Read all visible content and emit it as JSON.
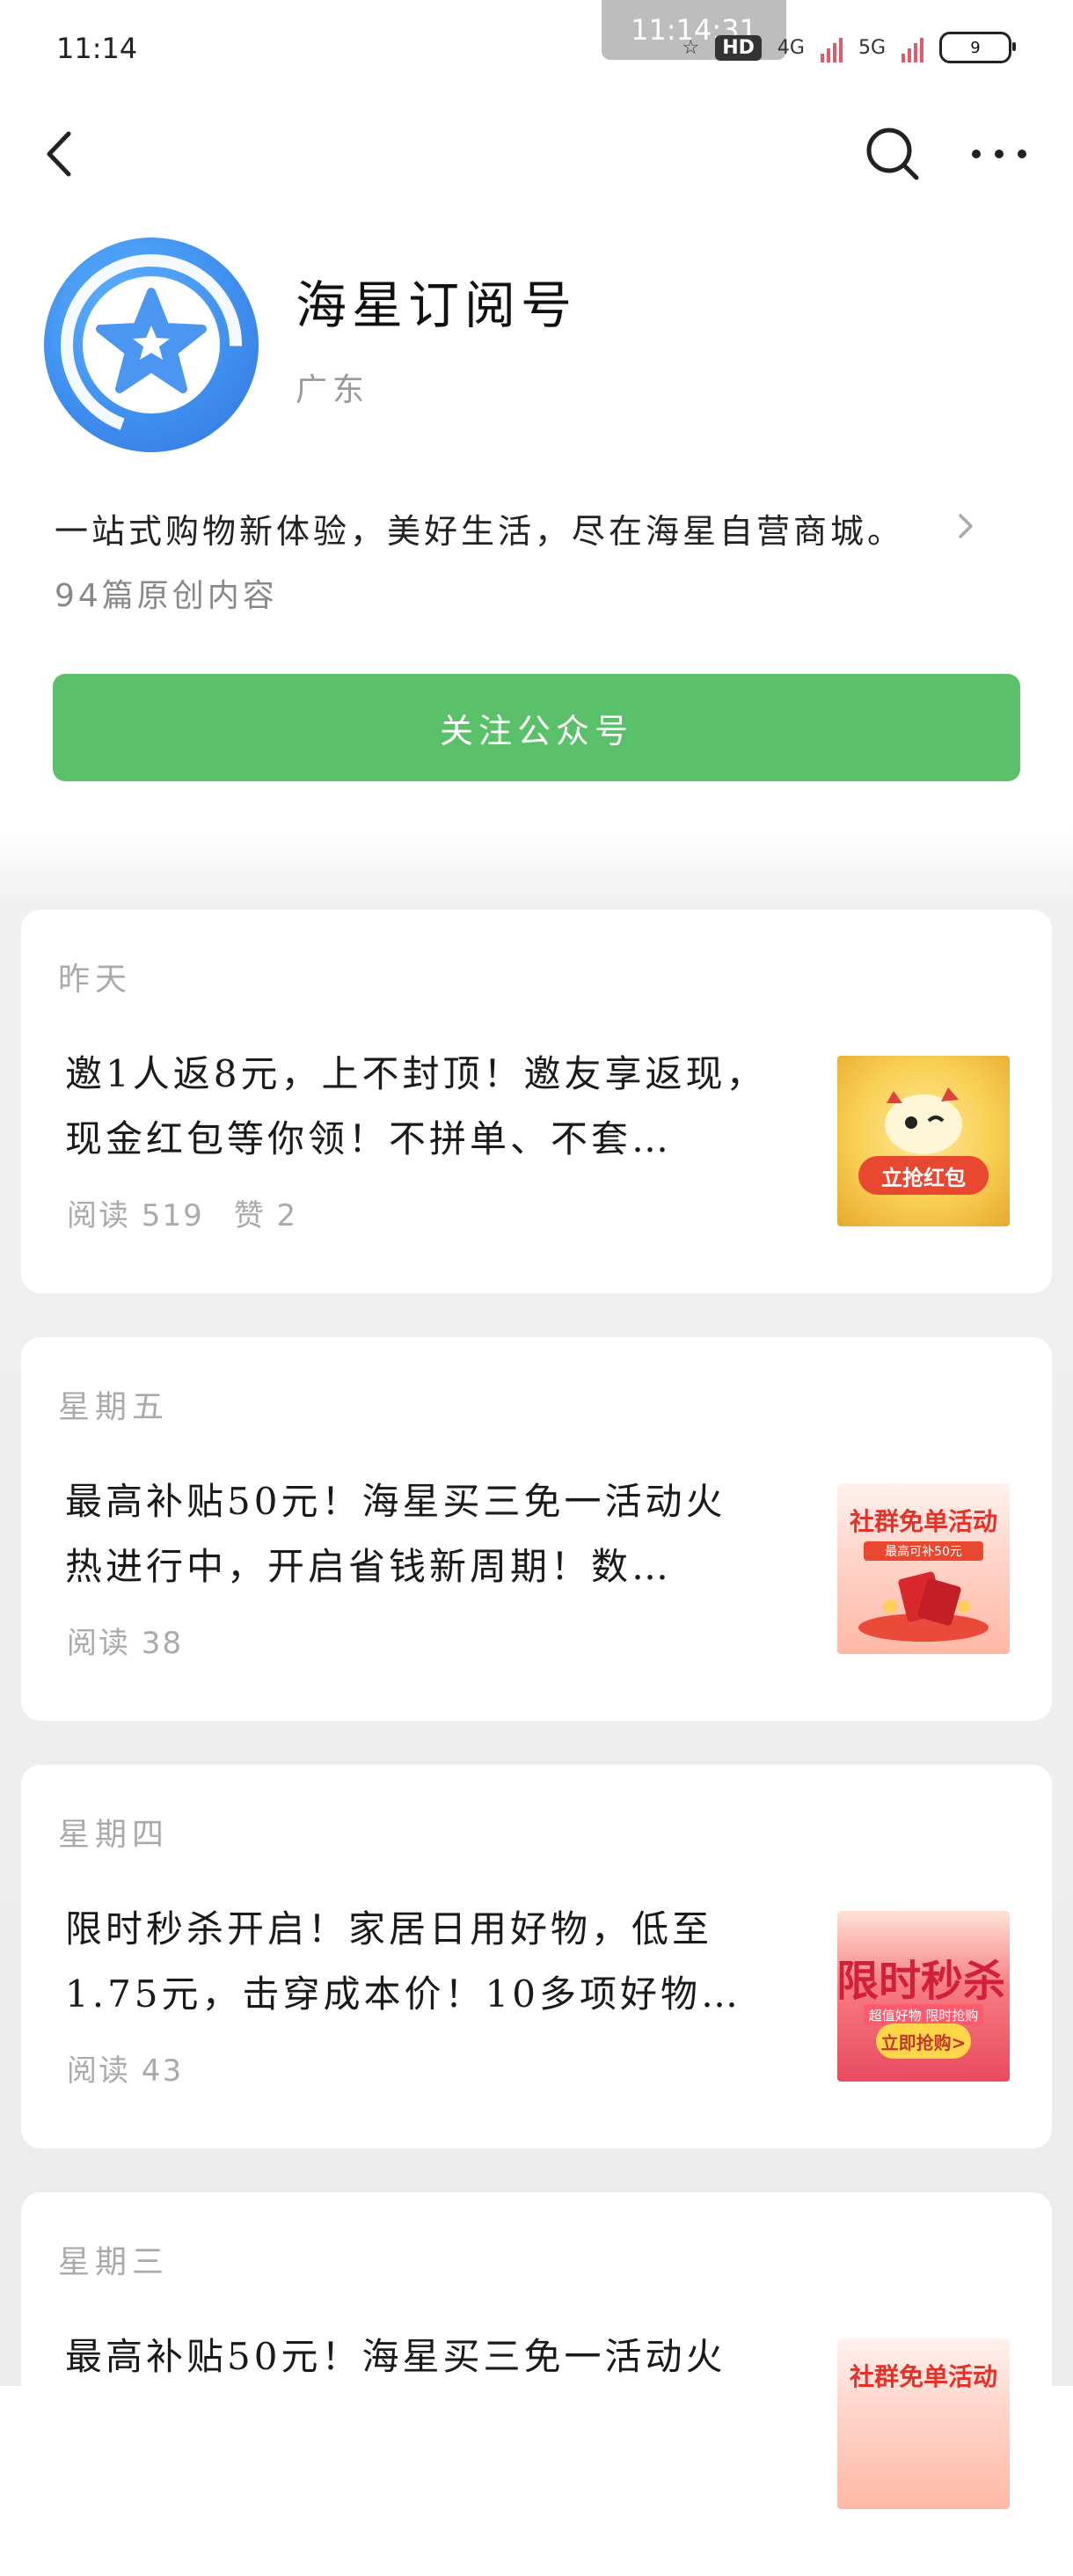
{
  "status_bar": {
    "time": "11:14",
    "recorder_time": "11:14:31",
    "hd_label": "HD",
    "network_4g": "4G",
    "network_5g": "5G",
    "battery": "9"
  },
  "nav": {
    "back_icon": "chevron-left-icon",
    "search_icon": "search-icon",
    "more_icon": "more-horizontal-icon"
  },
  "profile": {
    "name": "海星订阅号",
    "region": "广东",
    "description": "一站式购物新体验，美好生活，尽在海星自营商城。",
    "original_count": "94篇原创内容",
    "follow_label": "关注公众号",
    "avatar_colors": {
      "primary": "#3f8fef",
      "star": "#ffffff"
    },
    "follow_color": "#5ac06a"
  },
  "articles": [
    {
      "day": "昨天",
      "title_line1": "邀1人返8元，上不封顶！邀友享返现，",
      "title_line2": "现金红包等你领！不拼单、不套…",
      "reads": "阅读 519",
      "likes": "赞 2",
      "thumb_text": "立抢红包"
    },
    {
      "day": "星期五",
      "title_line1": "最高补贴50元！海星买三免一活动火",
      "title_line2": "热进行中，开启省钱新周期！数…",
      "reads": "阅读 38",
      "thumb_text": "社群免单活动",
      "thumb_sub": "最高可补50元"
    },
    {
      "day": "星期四",
      "title_line1": "限时秒杀开启！家居日用好物，低至",
      "title_line2": "1.75元，击穿成本价！10多项好物…",
      "reads": "阅读 43",
      "thumb_text": "限时秒杀",
      "thumb_sub": "超值好物 限时抢购",
      "thumb_btn": "立即抢购>"
    },
    {
      "day": "星期三",
      "title_line1": "最高补贴50元！海星买三免一活动火",
      "title_line2": "",
      "reads": "",
      "thumb_text": "社群免单活动"
    }
  ]
}
